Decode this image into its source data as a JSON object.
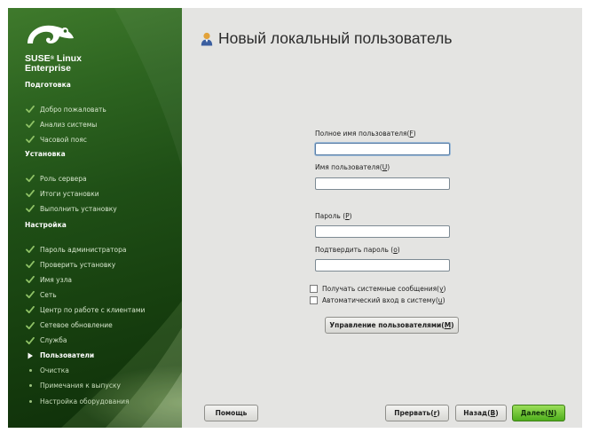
{
  "brand": {
    "line1": "SUSE",
    "reg": "®",
    "line1b": " Linux",
    "line2": "Enterprise"
  },
  "sidebar": {
    "sections": [
      {
        "title": "Подготовка",
        "items": [
          {
            "label": "Добро пожаловать",
            "state": "done"
          },
          {
            "label": "Анализ системы",
            "state": "done"
          },
          {
            "label": "Часовой пояс",
            "state": "done"
          }
        ]
      },
      {
        "title": "Установка",
        "items": [
          {
            "label": "Роль сервера",
            "state": "done"
          },
          {
            "label": "Итоги установки",
            "state": "done"
          },
          {
            "label": "Выполнить установку",
            "state": "done"
          }
        ]
      },
      {
        "title": "Настройка",
        "items": [
          {
            "label": "Пароль администратора",
            "state": "done"
          },
          {
            "label": "Проверить установку",
            "state": "done"
          },
          {
            "label": "Имя узла",
            "state": "done"
          },
          {
            "label": "Сеть",
            "state": "done"
          },
          {
            "label": "Центр по работе с клиентами",
            "state": "done"
          },
          {
            "label": "Сетевое обновление",
            "state": "done"
          },
          {
            "label": "Служба",
            "state": "done"
          },
          {
            "label": "Пользователи",
            "state": "current"
          },
          {
            "label": "Очистка",
            "state": "todo"
          },
          {
            "label": "Примечания к выпуску",
            "state": "todo"
          },
          {
            "label": "Настройка оборудования",
            "state": "todo"
          }
        ]
      }
    ]
  },
  "main": {
    "title": "Новый локальный пользователь",
    "full_name": {
      "label": "Полное имя пользователя",
      "key": "F",
      "value": ""
    },
    "username": {
      "label": "Имя пользователя",
      "key": "U",
      "value": ""
    },
    "password": {
      "label": "Пароль ",
      "key": "P",
      "value": ""
    },
    "confirm": {
      "label": "Подтвердить пароль ",
      "key": "o",
      "value": ""
    },
    "receive_mail": {
      "label": "Получать системные сообщения",
      "key": "y",
      "checked": false
    },
    "auto_login": {
      "label": "Автоматический вход в систему",
      "key": "u",
      "checked": false
    },
    "manage_users": {
      "label": "Управление пользователями",
      "key": "M"
    }
  },
  "buttons": {
    "help": "Помощь",
    "abort": {
      "label": "Прервать ",
      "key": "r"
    },
    "back": {
      "label": "Назад ",
      "key": "B"
    },
    "next": {
      "label": "Далее ",
      "key": "N"
    }
  },
  "colors": {
    "accent_green": "#4fae1c",
    "sidebar_green": "#1f4f16"
  }
}
